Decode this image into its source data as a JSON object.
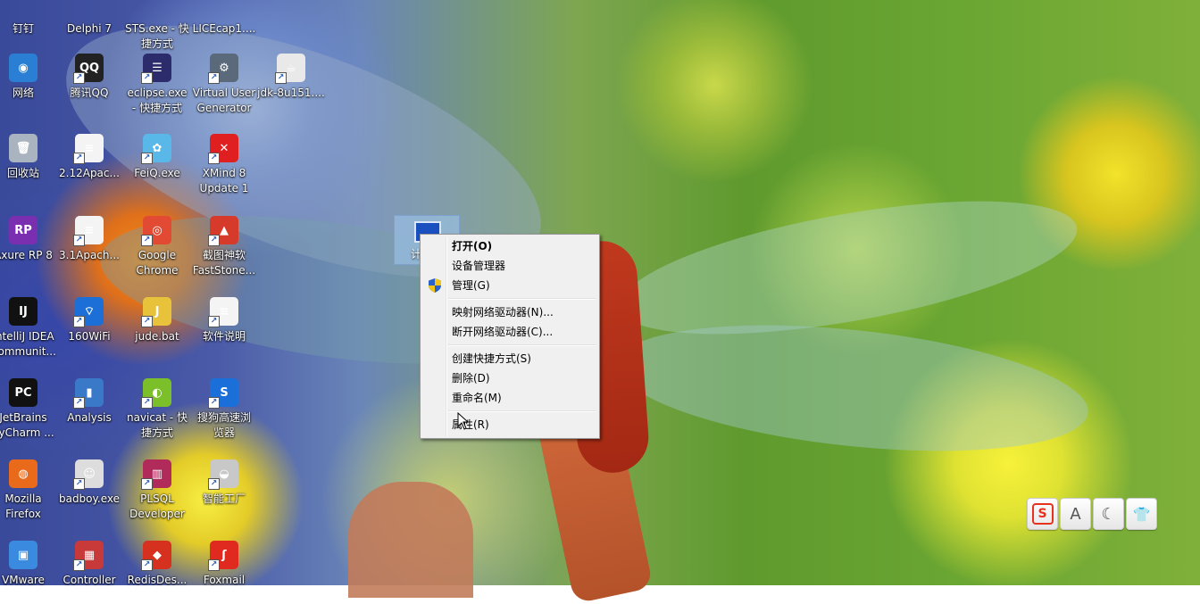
{
  "desktop": {
    "icons": [
      {
        "label": "钉钉",
        "glyph": "",
        "color": "#3a8ee6",
        "icon": "dingtalk-icon"
      },
      {
        "label": "Delphi 7",
        "glyph": "",
        "color": "#c33",
        "icon": "delphi-icon"
      },
      {
        "label": "STS.exe - 快\n捷方式",
        "glyph": "",
        "color": "#6b8e23",
        "icon": "sts-icon"
      },
      {
        "label": "LICEcap1....",
        "glyph": "",
        "color": "#777",
        "icon": "licecap-icon"
      },
      {
        "label": "网络",
        "glyph": "◉",
        "color": "#2a7fd4",
        "icon": "network-icon"
      },
      {
        "label": "腾讯QQ",
        "glyph": "QQ",
        "color": "#222",
        "icon": "qq-icon"
      },
      {
        "label": "eclipse.exe\n- 快捷方式",
        "glyph": "☰",
        "color": "#2c2c6c",
        "icon": "eclipse-icon"
      },
      {
        "label": "Virtual User\nGenerator",
        "glyph": "⚙",
        "color": "#5a6a7a",
        "icon": "virtual-user-generator-icon"
      },
      {
        "label": "jdk-8u151....",
        "glyph": "☕",
        "color": "#e9e9e9",
        "icon": "java-icon"
      },
      {
        "label": "回收站",
        "glyph": "🗑",
        "color": "#a9b4c0",
        "icon": "recycle-bin-icon"
      },
      {
        "label": "2.12Apac...",
        "glyph": "≡",
        "color": "#f4f4f4",
        "icon": "bat-file-icon"
      },
      {
        "label": "FeiQ.exe",
        "glyph": "✿",
        "color": "#59b8e8",
        "icon": "feiq-icon"
      },
      {
        "label": "XMind 8\nUpdate 1",
        "glyph": "✕",
        "color": "#e02020",
        "icon": "xmind-icon"
      },
      {
        "label": "Axure RP 8",
        "glyph": "RP",
        "color": "#7a2fb0",
        "icon": "axure-icon"
      },
      {
        "label": "3.1Apach...",
        "glyph": "≡",
        "color": "#f4f4f4",
        "icon": "bat-file-icon"
      },
      {
        "label": "Google\nChrome",
        "glyph": "◎",
        "color": "#e24a33",
        "icon": "chrome-icon"
      },
      {
        "label": "截图神软\nFastStone...",
        "glyph": "▲",
        "color": "#d63a2a",
        "icon": "faststone-icon"
      },
      {
        "label": "IntelliJ IDEA\nCommunit...",
        "glyph": "IJ",
        "color": "#111",
        "icon": "intellij-icon"
      },
      {
        "label": "160WiFi",
        "glyph": "⌔",
        "color": "#1c6fd6",
        "icon": "wifi-icon"
      },
      {
        "label": "jude.bat",
        "glyph": "J",
        "color": "#e8c23a",
        "icon": "jude-icon"
      },
      {
        "label": "软件说明",
        "glyph": "≡",
        "color": "#f4f4f4",
        "icon": "document-icon"
      },
      {
        "label": "JetBrains\nPyCharm ...",
        "glyph": "PC",
        "color": "#111",
        "icon": "pycharm-icon"
      },
      {
        "label": "Analysis",
        "glyph": "▮",
        "color": "#3a78c8",
        "icon": "analysis-icon"
      },
      {
        "label": "navicat - 快\n捷方式",
        "glyph": "◐",
        "color": "#7bbf2a",
        "icon": "navicat-icon"
      },
      {
        "label": "搜狗高速浏\n览器",
        "glyph": "S",
        "color": "#1a6fd8",
        "icon": "sogou-browser-icon"
      },
      {
        "label": "Mozilla\nFirefox",
        "glyph": "◍",
        "color": "#e86a1a",
        "icon": "firefox-icon"
      },
      {
        "label": "badboy.exe",
        "glyph": "☺",
        "color": "#ddd",
        "icon": "badboy-icon"
      },
      {
        "label": "PLSQL\nDeveloper",
        "glyph": "▥",
        "color": "#b02a5a",
        "icon": "plsql-icon"
      },
      {
        "label": "智能工厂",
        "glyph": "◒",
        "color": "#c8c8c8",
        "icon": "factory-icon"
      },
      {
        "label": "VMware",
        "glyph": "▣",
        "color": "#3a8ae0",
        "icon": "vmware-icon"
      },
      {
        "label": "Controller",
        "glyph": "▦",
        "color": "#c83a3a",
        "icon": "controller-icon"
      },
      {
        "label": "RedisDes...",
        "glyph": "◆",
        "color": "#d6301e",
        "icon": "redis-icon"
      },
      {
        "label": "Foxmail",
        "glyph": "ʃ",
        "color": "#e02a20",
        "icon": "foxmail-icon"
      }
    ],
    "selected_icon_partial_label": "计"
  },
  "context_menu": {
    "items": [
      {
        "label": "打开(O)",
        "bold": true
      },
      {
        "label": "设备管理器",
        "bold": false
      },
      {
        "label": "管理(G)",
        "bold": false,
        "icon": "uac-shield-icon"
      },
      {
        "label": "映射网络驱动器(N)...",
        "bold": false
      },
      {
        "label": "断开网络驱动器(C)...",
        "bold": false
      },
      {
        "label": "创建快捷方式(S)",
        "bold": false
      },
      {
        "label": "删除(D)",
        "bold": false
      },
      {
        "label": "重命名(M)",
        "bold": false
      },
      {
        "label": "属性(R)",
        "bold": false
      }
    ]
  },
  "toolbar": {
    "buttons": [
      {
        "glyph": "S",
        "icon": "sogou-input-icon",
        "color": "#e8321e"
      },
      {
        "glyph": "A",
        "icon": "input-mode-icon",
        "color": "#555"
      },
      {
        "glyph": "☾",
        "icon": "moon-icon",
        "color": "#555"
      },
      {
        "glyph": "👕",
        "icon": "skin-icon",
        "color": "#555"
      }
    ]
  }
}
